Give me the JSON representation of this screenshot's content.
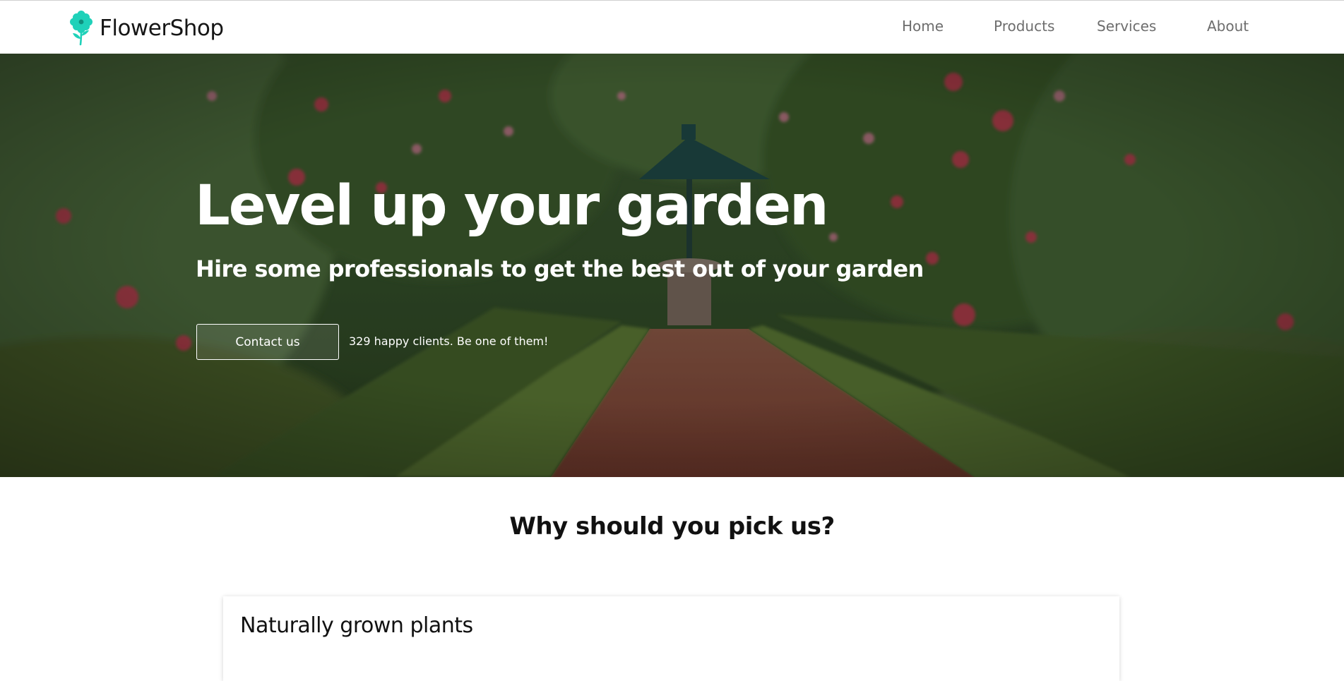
{
  "brand": {
    "name": "FlowerShop",
    "logo_icon": "flower-icon",
    "logo_color": "#1fd1b9"
  },
  "nav": {
    "items": [
      {
        "label": "Home"
      },
      {
        "label": "Products"
      },
      {
        "label": "Services"
      },
      {
        "label": "About"
      }
    ]
  },
  "hero": {
    "title": "Level up your garden",
    "subtitle": "Hire some professionals to get the best out of your garden",
    "contact_button": "Contact us",
    "clients_note": "329 happy clients. Be one of them!"
  },
  "why": {
    "title": "Why should you pick us?",
    "cards": [
      {
        "title": "Naturally grown plants"
      }
    ]
  },
  "colors": {
    "accent": "#1fd1b9",
    "nav_text": "#6d6d6d",
    "text_dark": "#111111"
  }
}
